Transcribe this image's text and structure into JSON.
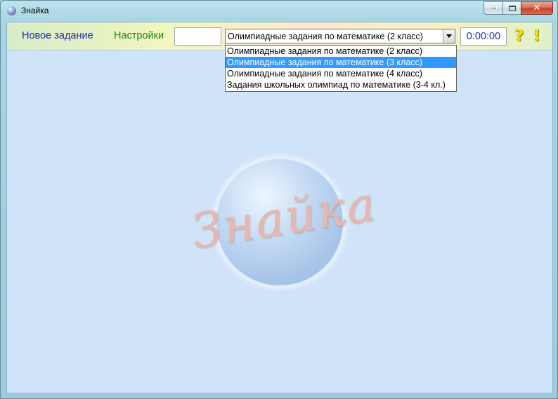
{
  "window": {
    "title": "Знайка",
    "minimize_icon": "minimize-icon",
    "maximize_icon": "maximize-icon",
    "close_icon": "close-icon",
    "close_glyph": "✕"
  },
  "toolbar": {
    "new_task_label": "Новое задание",
    "settings_label": "Настройки",
    "answer_input_value": "",
    "timer_value": "0:00:00",
    "help_glyph": "?",
    "info_glyph": "!",
    "help_icon": "question-mark-icon",
    "info_icon": "exclamation-icon"
  },
  "task_select": {
    "selected_value": "Олимпиадные задания по математике (2 класс)",
    "options": [
      "Олимпиадные задания по математике (2 класс)",
      "Олимпиадные задания по математике (3 класс)",
      "Олимпиадные задания по математике (4 класс)",
      "Задания школьных олимпиад по математике (3-4 кл.)"
    ],
    "highlighted_index": 1
  },
  "canvas": {
    "logo_text": "Знайка"
  },
  "colors": {
    "link_new": "#1f2fa8",
    "link_settings": "#1c8a15",
    "highlight": "#3399ff",
    "client_bg": "#cfe3f9"
  }
}
